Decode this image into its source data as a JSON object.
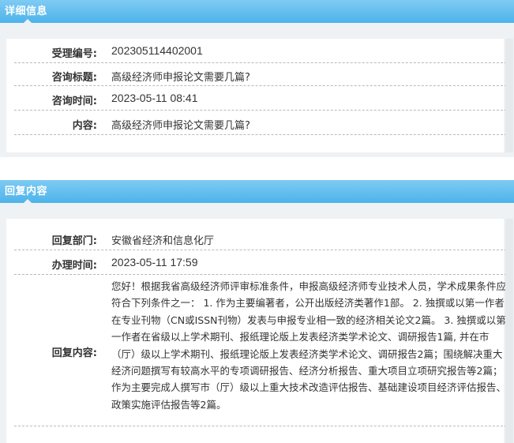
{
  "details": {
    "header_title": "详细信息",
    "rows": [
      {
        "label": "受理编号:",
        "value": "202305114402001"
      },
      {
        "label": "咨询标题:",
        "value": "高级经济师申报论文需要几篇?"
      },
      {
        "label": "咨询时间:",
        "value": "2023-05-11 08:41"
      },
      {
        "label": "内容:",
        "value": "高级经济师申报论文需要几篇?"
      }
    ]
  },
  "reply": {
    "header_title": "回复内容",
    "department_label": "回复部门:",
    "department_value": "安徽省经济和信息化厅",
    "time_label": "办理时间:",
    "time_value": "2023-05-11 17:59",
    "content_label": "回复内容:",
    "content_value": "您好！根据我省高级经济师评审标准条件，申报高级经济师专业技术人员，学术成果条件应符合下列条件之一： 1. 作为主要编著者，公开出版经济类著作1部。 2. 独撰或以第一作者在专业刊物（CN或ISSN刊物）发表与申报专业相一致的经济相关论文2篇。 3. 独撰或以第一作者在省级以上学术期刊、报纸理论版上发表经济类学术论文、调研报告1篇, 并在市（厅）级以上学术期刊、报纸理论版上发表经济类学术论文、调研报告2篇；围绕解决重大经济问题撰写有较高水平的专项调研报告、经济分析报告、重大项目立项研究报告等2篇；作为主要完成人撰写市（厅）级以上重大技术改造评估报告、基础建设项目经济评估报告、政策实施评估报告等2篇。"
  }
}
